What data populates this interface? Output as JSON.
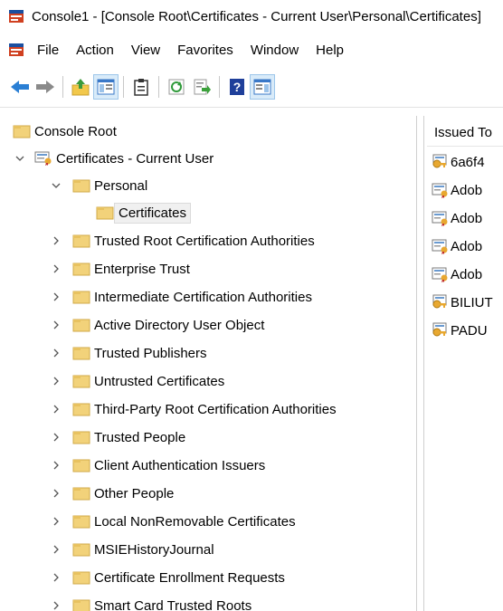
{
  "window": {
    "title": "Console1 - [Console Root\\Certificates - Current User\\Personal\\Certificates]"
  },
  "menu": [
    {
      "label": "File"
    },
    {
      "label": "Action"
    },
    {
      "label": "View"
    },
    {
      "label": "Favorites"
    },
    {
      "label": "Window"
    },
    {
      "label": "Help"
    }
  ],
  "toolbar": [
    "back-arrow-icon",
    "forward-arrow-icon",
    "up-folder-icon",
    "show-hide-console-tree-icon",
    "clipboard-icon",
    "refresh-icon",
    "export-list-icon",
    "help-icon",
    "show-hide-action-pane-icon"
  ],
  "tree": {
    "root": "Console Root",
    "snapin": "Certificates - Current User",
    "personal": "Personal",
    "certificates": "Certificates",
    "stores": [
      "Trusted Root Certification Authorities",
      "Enterprise Trust",
      "Intermediate Certification Authorities",
      "Active Directory User Object",
      "Trusted Publishers",
      "Untrusted Certificates",
      "Third-Party Root Certification Authorities",
      "Trusted People",
      "Client Authentication Issuers",
      "Other People",
      "Local NonRemovable Certificates",
      "MSIEHistoryJournal",
      "Certificate Enrollment Requests",
      "Smart Card Trusted Roots"
    ]
  },
  "list": {
    "header": "Issued To",
    "rows": [
      {
        "text": "6a6f4",
        "icon": "cert-key-icon"
      },
      {
        "text": "Adob",
        "icon": "cert-icon"
      },
      {
        "text": "Adob",
        "icon": "cert-icon"
      },
      {
        "text": "Adob",
        "icon": "cert-icon"
      },
      {
        "text": "Adob",
        "icon": "cert-icon"
      },
      {
        "text": "BILIUT",
        "icon": "cert-key-icon"
      },
      {
        "text": "PADU",
        "icon": "cert-key-icon"
      }
    ]
  },
  "colors": {
    "folder": "#f2d27a",
    "accent": "#1e78d7",
    "selection": "#f0f0f0"
  }
}
